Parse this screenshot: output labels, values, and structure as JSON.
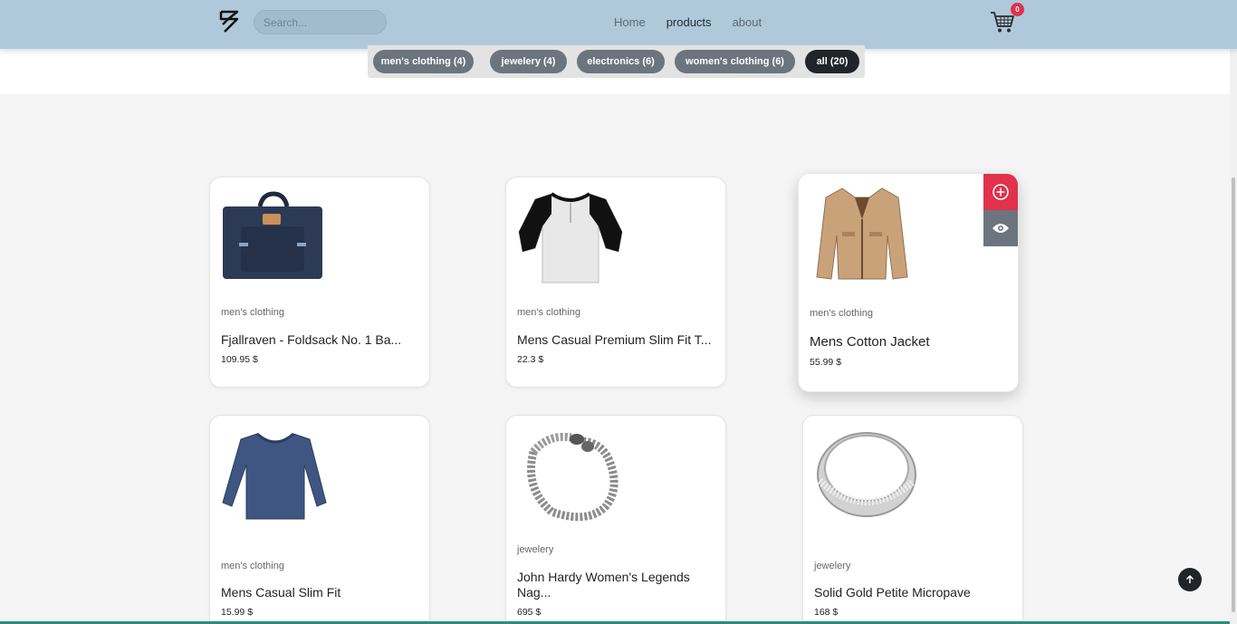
{
  "nav": {
    "search_placeholder": "Search...",
    "links": [
      {
        "label": "Home"
      },
      {
        "label": "products"
      },
      {
        "label": "about"
      }
    ],
    "cart_count": "0"
  },
  "filters": [
    {
      "label": "men's clothing (4)"
    },
    {
      "label": "jewelery (4)"
    },
    {
      "label": "electronics (6)"
    },
    {
      "label": "women's clothing (6)"
    },
    {
      "label": "all (20)"
    }
  ],
  "products": [
    {
      "category": "men's clothing",
      "title": "Fjallraven - Foldsack No. 1 Ba...",
      "price": "109.95 $",
      "icon": "backpack-image"
    },
    {
      "category": "men's clothing",
      "title": "Mens Casual Premium Slim Fit T...",
      "price": "22.3 $",
      "icon": "raglan-tshirt-image"
    },
    {
      "category": "men's clothing",
      "title": "Mens Cotton Jacket",
      "price": "55.99 $",
      "icon": "jacket-image"
    },
    {
      "category": "men's clothing",
      "title": "Mens Casual Slim Fit",
      "price": "15.99 $",
      "icon": "long-sleeve-shirt-image"
    },
    {
      "category": "jewelery",
      "title": "John Hardy Women's Legends Nag...",
      "price": "695 $",
      "icon": "chain-bracelet-image"
    },
    {
      "category": "jewelery",
      "title": "Solid Gold Petite Micropave",
      "price": "168 $",
      "icon": "ring-image"
    }
  ],
  "colors": {
    "navbar": "#afc9db",
    "accent_red": "#e0314d",
    "chip_gray": "#6c757d",
    "chip_active": "#212529"
  }
}
